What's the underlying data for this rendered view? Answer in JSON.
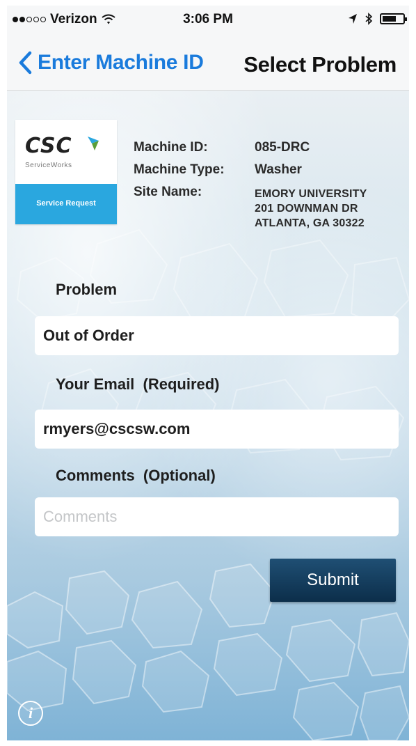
{
  "status_bar": {
    "carrier": "Verizon",
    "time": "3:06 PM",
    "signal_bars_filled": 2,
    "signal_bars_total": 5
  },
  "nav": {
    "back_label": "Enter Machine ID",
    "title": "Select Problem"
  },
  "logo": {
    "brand": "CSC",
    "tagline": "ServiceWorks",
    "banner": "Service Request"
  },
  "machine": {
    "id_label": "Machine ID:",
    "id_value": "085-DRC",
    "type_label": "Machine Type:",
    "type_value": "Washer",
    "site_label": "Site Name:",
    "site_line1": "EMORY UNIVERSITY",
    "site_line2": "201 DOWNMAN DR",
    "site_line3": "ATLANTA, GA 30322"
  },
  "form": {
    "problem_label": "Problem",
    "problem_value": "Out of Order",
    "email_label": "Your Email  (Required)",
    "email_value": "rmyers@cscsw.com",
    "comments_label": "Comments  (Optional)",
    "comments_placeholder": "Comments",
    "submit_label": "Submit"
  },
  "footer": {
    "info_glyph": "i"
  },
  "colors": {
    "accent": "#1a7bdc",
    "banner": "#2aa7df",
    "submit": "#0c2e4a"
  }
}
